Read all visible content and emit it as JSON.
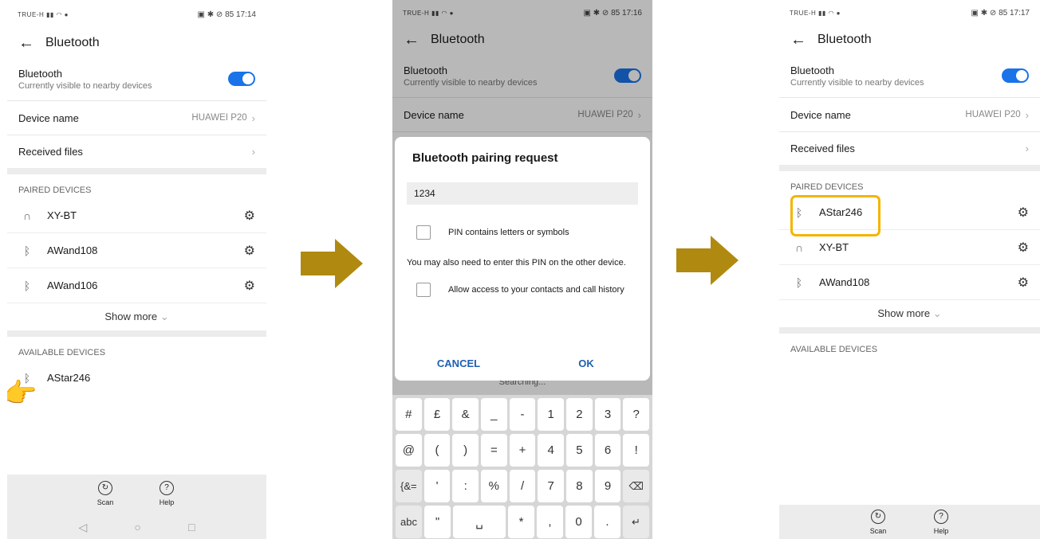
{
  "screen1": {
    "status": {
      "carrier": "TRUE-H",
      "time": "17:14",
      "battery": "85"
    },
    "header": {
      "title": "Bluetooth"
    },
    "bt_toggle": {
      "label": "Bluetooth",
      "sub": "Currently visible to nearby devices"
    },
    "device_name": {
      "label": "Device name",
      "value": "HUAWEI P20"
    },
    "received_files": {
      "label": "Received files"
    },
    "paired_header": "PAIRED DEVICES",
    "paired": [
      {
        "name": "XY-BT",
        "icon": "headphones-icon"
      },
      {
        "name": "AWand108",
        "icon": "bluetooth-icon"
      },
      {
        "name": "AWand106",
        "icon": "bluetooth-icon"
      }
    ],
    "show_more": "Show more",
    "available_header": "AVAILABLE DEVICES",
    "available": [
      {
        "name": "AStar246",
        "icon": "bluetooth-icon"
      }
    ],
    "bottom": {
      "scan": "Scan",
      "help": "Help"
    }
  },
  "screen2": {
    "status": {
      "carrier": "TRUE-H",
      "time": "17:16",
      "battery": "85"
    },
    "header": {
      "title": "Bluetooth"
    },
    "bt_toggle": {
      "label": "Bluetooth",
      "sub": "Currently visible to nearby devices"
    },
    "device_name": {
      "label": "Device name",
      "value": "HUAWEI P20"
    },
    "searching": "Searching...",
    "dialog": {
      "title": "Bluetooth pairing request",
      "pin_value": "1234",
      "pin_check": "PIN contains letters or symbols",
      "note": "You may also need to enter this PIN on the other device.",
      "contacts_check": "Allow access to your contacts and call history",
      "cancel": "CANCEL",
      "ok": "OK"
    },
    "keyboard": [
      [
        "#",
        "£",
        "&",
        "_",
        "-",
        "1",
        "2",
        "3",
        "?"
      ],
      [
        "@",
        "(",
        ")",
        "=",
        "+",
        "4",
        "5",
        "6",
        "!"
      ],
      [
        "{&=",
        "'",
        ":",
        "%",
        "/",
        "7",
        "8",
        "9",
        "⌫"
      ],
      [
        "abc",
        "\"",
        "␣",
        "*",
        ",",
        "0",
        ".",
        "↵"
      ]
    ]
  },
  "screen3": {
    "status": {
      "carrier": "TRUE-H",
      "time": "17:17",
      "battery": "85"
    },
    "header": {
      "title": "Bluetooth"
    },
    "bt_toggle": {
      "label": "Bluetooth",
      "sub": "Currently visible to nearby devices"
    },
    "device_name": {
      "label": "Device name",
      "value": "HUAWEI P20"
    },
    "received_files": {
      "label": "Received files"
    },
    "paired_header": "PAIRED DEVICES",
    "paired": [
      {
        "name": "AStar246",
        "icon": "bluetooth-icon"
      },
      {
        "name": "XY-BT",
        "icon": "headphones-icon"
      },
      {
        "name": "AWand108",
        "icon": "bluetooth-icon"
      }
    ],
    "show_more": "Show more",
    "available_header": "AVAILABLE DEVICES",
    "bottom": {
      "scan": "Scan",
      "help": "Help"
    }
  },
  "colors": {
    "accent": "#1a73e8",
    "arrow": "#b08a10",
    "highlight": "#f4b400",
    "dialog_button": "#1f5fb0"
  }
}
